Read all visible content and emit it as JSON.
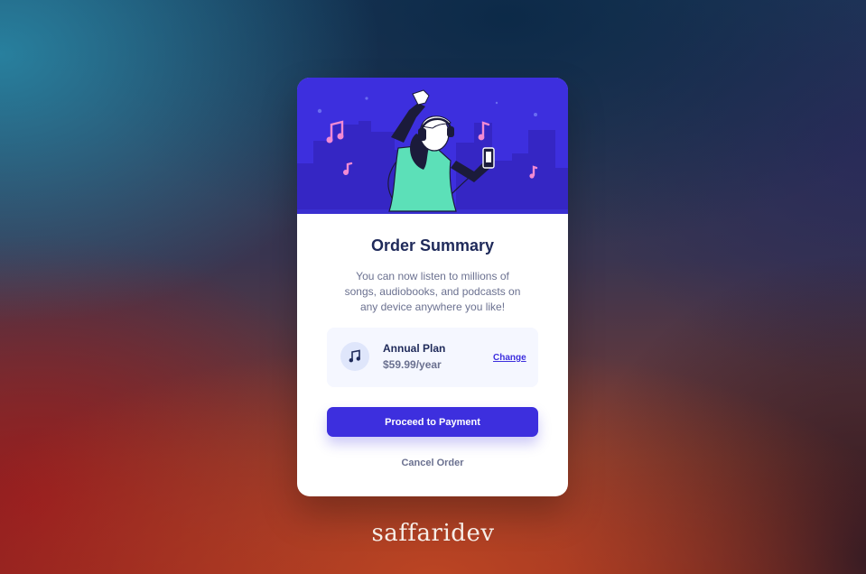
{
  "card": {
    "title": "Order Summary",
    "description": "You can now listen to millions of songs, audiobooks, and podcasts on any device anywhere you like!",
    "plan": {
      "name": "Annual Plan",
      "price": "$59.99/year",
      "change_label": "Change",
      "icon": "music-note-icon"
    },
    "proceed_label": "Proceed to Payment",
    "cancel_label": "Cancel Order"
  },
  "footer": {
    "brand": "saffaridev"
  },
  "colors": {
    "accent": "#3d2fde",
    "title": "#1f2a5a",
    "muted": "#6b7190",
    "plan_bg": "#f5f7ff",
    "hero_bg": "#3d2fde"
  }
}
